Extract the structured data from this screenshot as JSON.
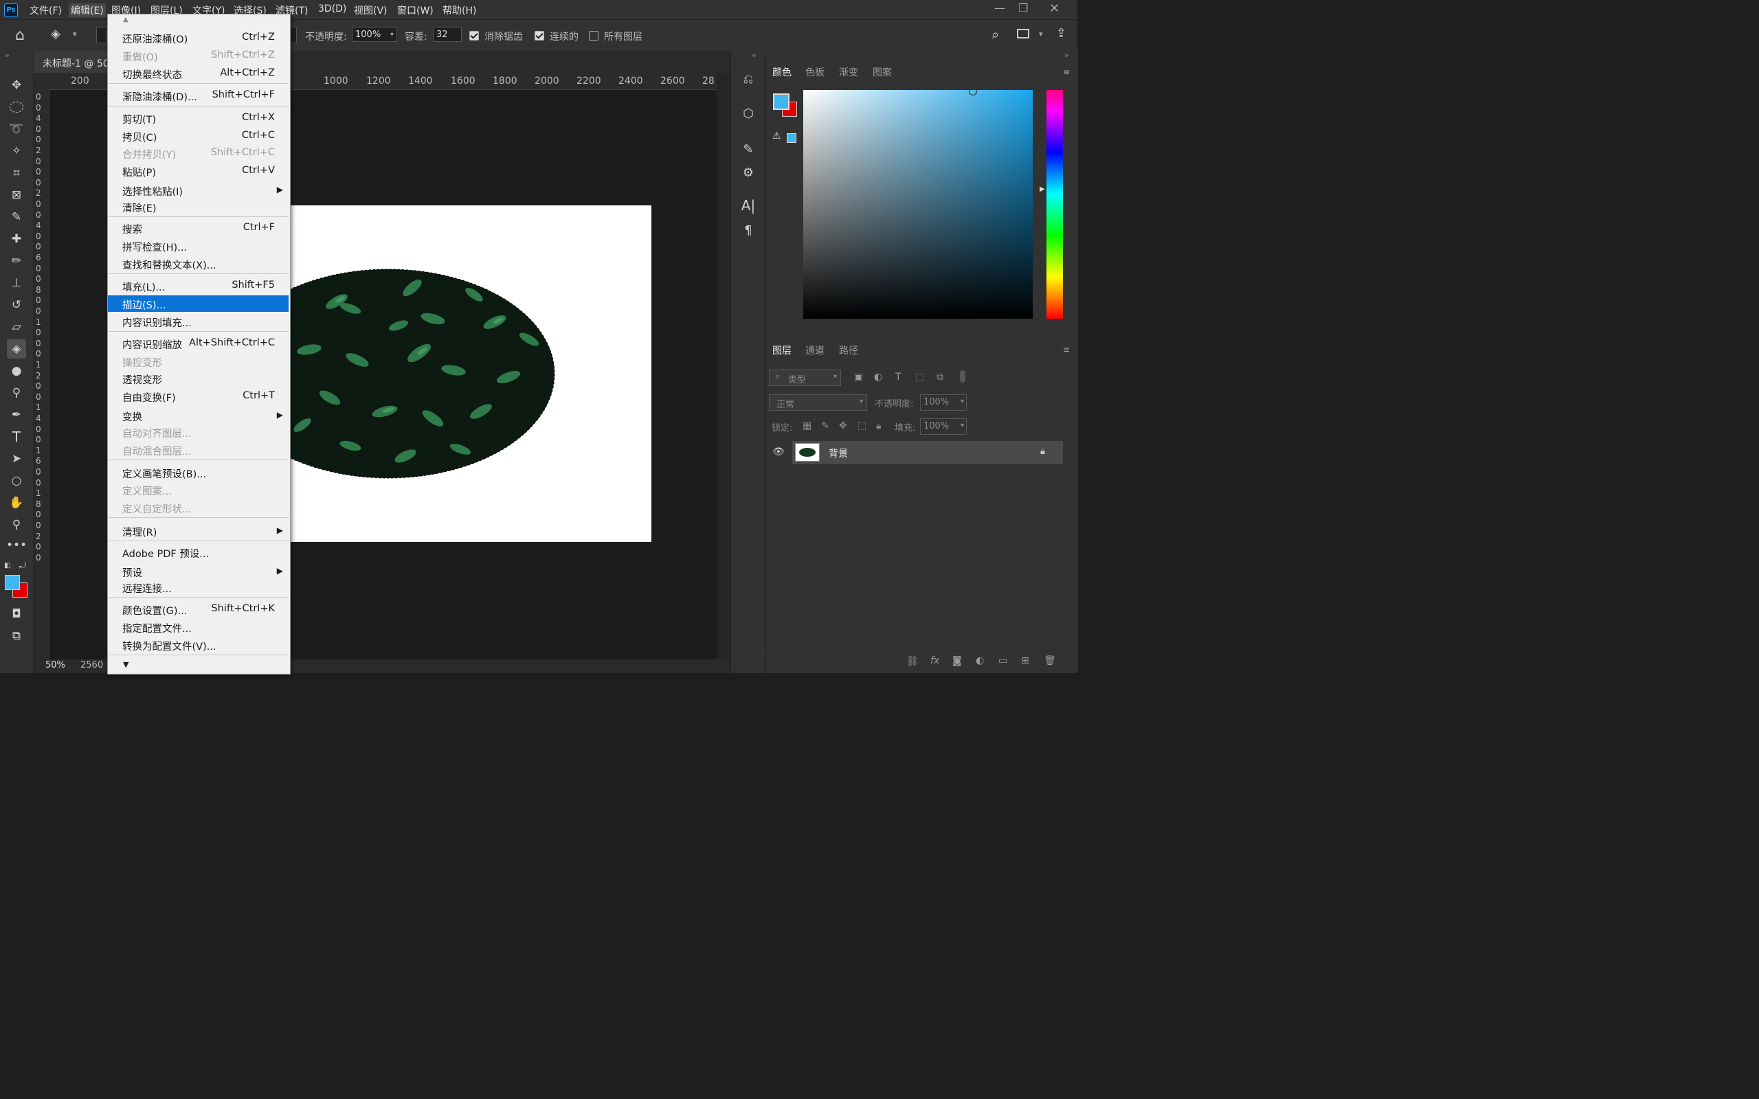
{
  "menubar": {
    "app_icon": "Ps",
    "items": [
      "文件(F)",
      "编辑(E)",
      "图像(I)",
      "图层(L)",
      "文字(Y)",
      "选择(S)",
      "滤镜(T)",
      "3D(D)",
      "视图(V)",
      "窗口(W)",
      "帮助(H)"
    ]
  },
  "options": {
    "opacity_label": "不透明度:",
    "opacity_value": "100%",
    "tolerance_label": "容差:",
    "tolerance_value": "32",
    "antialias_label": "消除锯齿",
    "contiguous_label": "连续的",
    "all_layers_label": "所有图层"
  },
  "document": {
    "tab_title": "未标题-1 @ 50",
    "ruler_labels": [
      "200",
      "1000",
      "1200",
      "1400",
      "1600",
      "1800",
      "2000",
      "2200",
      "2400",
      "2600",
      "28"
    ],
    "vruler_labels": [
      "0",
      "0",
      "4",
      "0",
      "0",
      "2",
      "0",
      "0",
      "0",
      "2",
      "0",
      "0",
      "4",
      "0",
      "0",
      "6",
      "0",
      "0",
      "8",
      "0",
      "0",
      "1",
      "0",
      "0",
      "0",
      "1",
      "2",
      "0",
      "0",
      "1",
      "4",
      "0",
      "0",
      "1",
      "6",
      "0",
      "0",
      "1",
      "8",
      "0",
      "0",
      "2",
      "0",
      "0"
    ],
    "zoom": "50%",
    "status_size": "2560"
  },
  "edit_menu": {
    "items": [
      {
        "label": "还原油漆桶(O)",
        "shortcut": "Ctrl+Z",
        "disabled": false
      },
      {
        "label": "重做(O)",
        "shortcut": "Shift+Ctrl+Z",
        "disabled": true
      },
      {
        "label": "切换最终状态",
        "shortcut": "Alt+Ctrl+Z",
        "disabled": false
      },
      {
        "label": "渐隐油漆桶(D)...",
        "shortcut": "Shift+Ctrl+F",
        "disabled": false
      },
      {
        "label": "剪切(T)",
        "shortcut": "Ctrl+X",
        "disabled": false
      },
      {
        "label": "拷贝(C)",
        "shortcut": "Ctrl+C",
        "disabled": false
      },
      {
        "label": "合并拷贝(Y)",
        "shortcut": "Shift+Ctrl+C",
        "disabled": true
      },
      {
        "label": "粘贴(P)",
        "shortcut": "Ctrl+V",
        "disabled": false
      },
      {
        "label": "选择性粘贴(I)",
        "shortcut": "",
        "disabled": false
      },
      {
        "label": "清除(E)",
        "shortcut": "",
        "disabled": false
      },
      {
        "label": "搜索",
        "shortcut": "Ctrl+F",
        "disabled": false
      },
      {
        "label": "拼写检查(H)...",
        "shortcut": "",
        "disabled": false
      },
      {
        "label": "查找和替换文本(X)...",
        "shortcut": "",
        "disabled": false
      },
      {
        "label": "填充(L)...",
        "shortcut": "Shift+F5",
        "disabled": false
      },
      {
        "label": "描边(S)...",
        "shortcut": "",
        "disabled": false
      },
      {
        "label": "内容识别填充...",
        "shortcut": "",
        "disabled": false
      },
      {
        "label": "内容识别缩放",
        "shortcut": "Alt+Shift+Ctrl+C",
        "disabled": false
      },
      {
        "label": "操控变形",
        "shortcut": "",
        "disabled": true
      },
      {
        "label": "透视变形",
        "shortcut": "",
        "disabled": false
      },
      {
        "label": "自由变换(F)",
        "shortcut": "Ctrl+T",
        "disabled": false
      },
      {
        "label": "变换",
        "shortcut": "",
        "disabled": false
      },
      {
        "label": "自动对齐图层...",
        "shortcut": "",
        "disabled": true
      },
      {
        "label": "自动混合图层...",
        "shortcut": "",
        "disabled": true
      },
      {
        "label": "定义画笔预设(B)...",
        "shortcut": "",
        "disabled": false
      },
      {
        "label": "定义图案...",
        "shortcut": "",
        "disabled": true
      },
      {
        "label": "定义自定形状...",
        "shortcut": "",
        "disabled": true
      },
      {
        "label": "清理(R)",
        "shortcut": "",
        "disabled": false
      },
      {
        "label": "Adobe PDF 预设...",
        "shortcut": "",
        "disabled": false
      },
      {
        "label": "预设",
        "shortcut": "",
        "disabled": false
      },
      {
        "label": "远程连接...",
        "shortcut": "",
        "disabled": false
      },
      {
        "label": "颜色设置(G)...",
        "shortcut": "Shift+Ctrl+K",
        "disabled": false
      },
      {
        "label": "指定配置文件...",
        "shortcut": "",
        "disabled": false
      },
      {
        "label": "转换为配置文件(V)...",
        "shortcut": "",
        "disabled": false
      }
    ]
  },
  "color_panel": {
    "tabs": [
      "颜色",
      "色板",
      "渐变",
      "图案"
    ],
    "foreground": "#3fb6ef",
    "background": "#e00000"
  },
  "layers_panel": {
    "tabs": [
      "图层",
      "通道",
      "路径"
    ],
    "filter_placeholder": "类型",
    "blend_mode": "正常",
    "opacity_label": "不透明度:",
    "opacity_value": "100%",
    "lock_label": "锁定:",
    "fill_label": "填充:",
    "fill_value": "100%",
    "layer_name": "背景"
  }
}
